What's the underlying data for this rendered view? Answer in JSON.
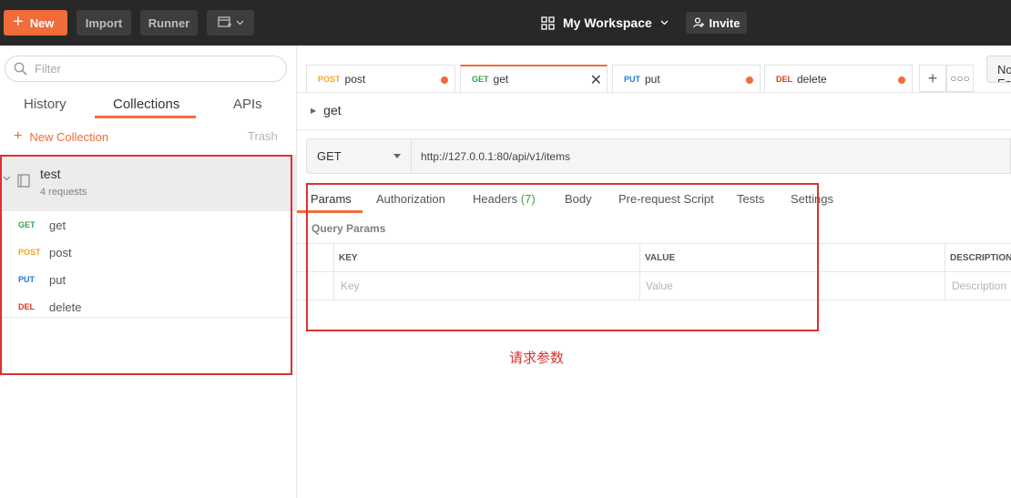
{
  "colors": {
    "accent": "#f26b3a",
    "get": "#3aa14a",
    "post": "#f5a623",
    "put": "#1e7bd6",
    "del": "#d9391a",
    "annotation": "#e03030"
  },
  "topbar": {
    "new_label": "New",
    "import_label": "Import",
    "runner_label": "Runner",
    "workspace_label": "My Workspace",
    "invite_label": "Invite"
  },
  "sidebar": {
    "filter_placeholder": "Filter",
    "tabs": [
      {
        "label": "History"
      },
      {
        "label": "Collections"
      },
      {
        "label": "APIs"
      }
    ],
    "new_collection_label": "New Collection",
    "trash_label": "Trash",
    "collection": {
      "name": "test",
      "count": "4 requests"
    },
    "requests": [
      {
        "method": "GET",
        "name": "get"
      },
      {
        "method": "POST",
        "name": "post"
      },
      {
        "method": "PUT",
        "name": "put"
      },
      {
        "method": "DEL",
        "name": "delete"
      }
    ]
  },
  "tabs": [
    {
      "method": "POST",
      "name": "post"
    },
    {
      "method": "GET",
      "name": "get"
    },
    {
      "method": "PUT",
      "name": "put"
    },
    {
      "method": "DEL",
      "name": "delete"
    }
  ],
  "environment": {
    "label": "No Environment"
  },
  "request": {
    "breadcrumb": "get",
    "method": "GET",
    "url": "http://127.0.0.1:80/api/v1/items",
    "tabs": [
      {
        "label": "Params"
      },
      {
        "label": "Authorization"
      },
      {
        "label": "Headers",
        "count": "(7)"
      },
      {
        "label": "Body"
      },
      {
        "label": "Pre-request Script"
      },
      {
        "label": "Tests"
      },
      {
        "label": "Settings"
      }
    ],
    "query_params_title": "Query Params",
    "table": {
      "headers": [
        "KEY",
        "VALUE",
        "DESCRIPTION"
      ],
      "placeholders": [
        "Key",
        "Value",
        "Description"
      ]
    }
  },
  "annotation": "请求参数"
}
